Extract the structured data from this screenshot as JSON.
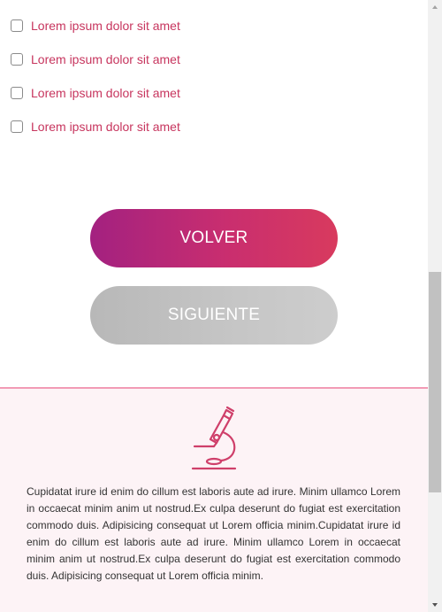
{
  "checkboxes": [
    {
      "label": "Lorem ipsum dolor sit amet",
      "checked": false
    },
    {
      "label": "Lorem ipsum dolor sit amet",
      "checked": false
    },
    {
      "label": "Lorem ipsum dolor sit amet",
      "checked": false
    },
    {
      "label": "Lorem ipsum dolor sit amet",
      "checked": false
    }
  ],
  "buttons": {
    "back_label": "VOLVER",
    "next_label": "SIGUIENTE"
  },
  "footer": {
    "icon": "microscope-icon",
    "text": "Cupidatat irure id enim do cillum est laboris aute ad irure. Minim ullamco Lorem in occaecat minim anim ut nostrud.Ex culpa deserunt do fugiat est exercitation commodo duis. Adipisicing consequat ut Lorem officia minim.Cupidatat irure id enim do cillum est laboris aute ad irure. Minim ullamco Lorem in occaecat minim anim ut nostrud.Ex culpa deserunt do fugiat est exercitation commodo duis. Adipisicing consequat ut Lorem officia minim."
  },
  "colors": {
    "accent": "#c7355e",
    "gradient_start": "#a32180",
    "gradient_end": "#d83a5e",
    "disabled": "#c6c6c6",
    "footer_bg": "#fdf3f6",
    "footer_border": "#f29bb5"
  }
}
